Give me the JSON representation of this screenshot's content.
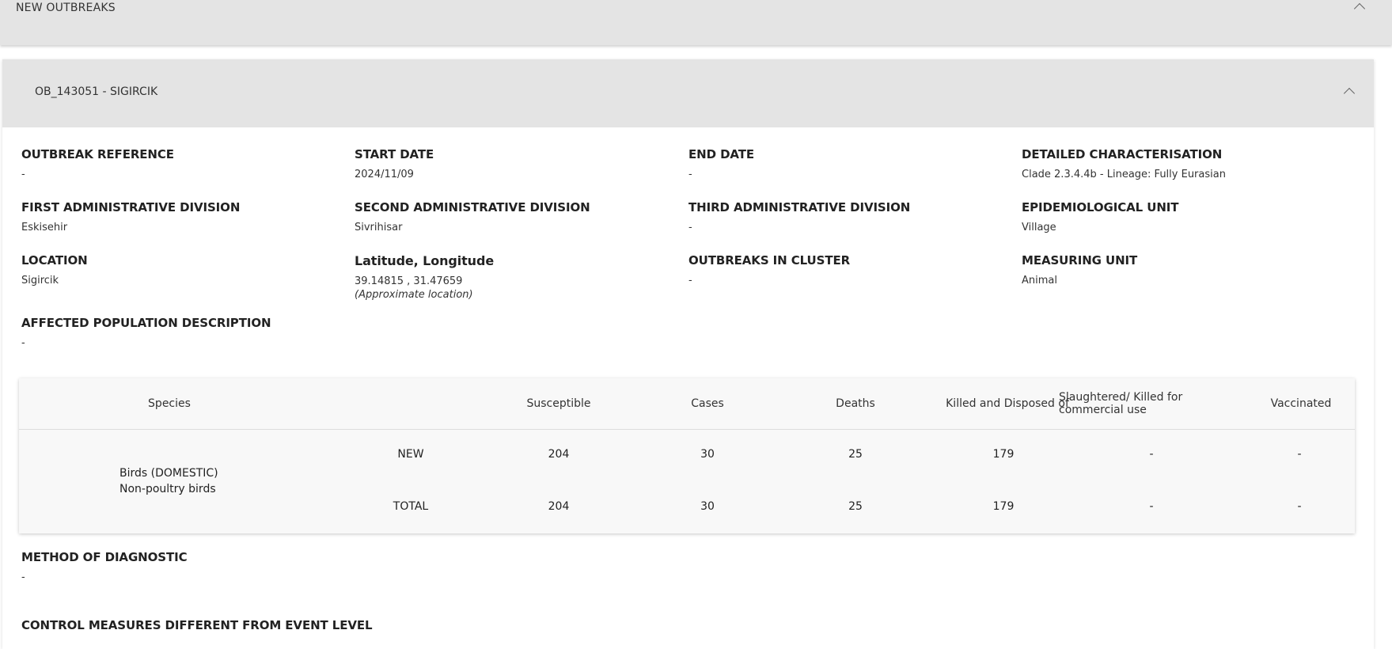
{
  "top_section": {
    "title": "NEW OUTBREAKS"
  },
  "outbreak": {
    "header": "OB_143051 - SIGIRCIK",
    "fields": {
      "outbreak_reference": {
        "label": "OUTBREAK REFERENCE",
        "value": "-"
      },
      "start_date": {
        "label": "START DATE",
        "value": "2024/11/09"
      },
      "end_date": {
        "label": "END DATE",
        "value": "-"
      },
      "detailed_characterisation": {
        "label": "DETAILED CHARACTERISATION",
        "value": "Clade 2.3.4.4b - Lineage: Fully Eurasian"
      },
      "first_admin_division": {
        "label": "FIRST ADMINISTRATIVE DIVISION",
        "value": "Eskisehir"
      },
      "second_admin_division": {
        "label": "SECOND ADMINISTRATIVE DIVISION",
        "value": "Sivrihisar"
      },
      "third_admin_division": {
        "label": "THIRD ADMINISTRATIVE DIVISION",
        "value": "-"
      },
      "epidemiological_unit": {
        "label": "EPIDEMIOLOGICAL UNIT",
        "value": "Village"
      },
      "location": {
        "label": "LOCATION",
        "value": "Sigircik"
      },
      "lat_long": {
        "label": "Latitude, Longitude",
        "value": "39.14815 , 31.47659",
        "note": "(Approximate location)"
      },
      "outbreaks_in_cluster": {
        "label": "OUTBREAKS IN CLUSTER",
        "value": "-"
      },
      "measuring_unit": {
        "label": "MEASURING UNIT",
        "value": "Animal"
      },
      "affected_population": {
        "label": "AFFECTED POPULATION DESCRIPTION",
        "value": "-"
      },
      "method_of_diagnostic": {
        "label": "METHOD OF DIAGNOSTIC",
        "value": "-"
      },
      "control_measures": {
        "label": "CONTROL MEASURES DIFFERENT FROM EVENT LEVEL"
      }
    },
    "table": {
      "headers": {
        "species": "Species",
        "susceptible": "Susceptible",
        "cases": "Cases",
        "deaths": "Deaths",
        "killed": "Killed and Disposed of",
        "slaughtered": "Slaughtered/ Killed for commercial use",
        "vaccinated": "Vaccinated"
      },
      "species_line1": "Birds (DOMESTIC)",
      "species_line2": "Non-poultry birds",
      "rows": [
        {
          "type": "NEW",
          "susceptible": "204",
          "cases": "30",
          "deaths": "25",
          "killed": "179",
          "slaughtered": "-",
          "vaccinated": "-"
        },
        {
          "type": "TOTAL",
          "susceptible": "204",
          "cases": "30",
          "deaths": "25",
          "killed": "179",
          "slaughtered": "-",
          "vaccinated": "-"
        }
      ]
    }
  }
}
